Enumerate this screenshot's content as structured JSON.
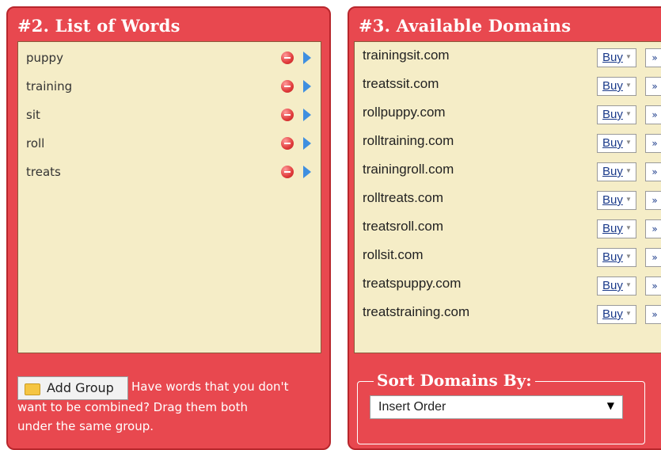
{
  "words_panel": {
    "title": "#2. List of Words",
    "words": [
      "puppy",
      "training",
      "sit",
      "roll",
      "treats"
    ],
    "add_group_label": "Add Group",
    "help_line1": "Have words that you don't",
    "help_line2": "want to be combined?  Drag them both",
    "help_line3": "under the same group."
  },
  "domains_panel": {
    "title": "#3. Available Domains",
    "domains": [
      "trainingsit.com",
      "treatssit.com",
      "rollpuppy.com",
      "rolltraining.com",
      "trainingroll.com",
      "rolltreats.com",
      "treatsroll.com",
      "rollsit.com",
      "treatspuppy.com",
      "treatstraining.com"
    ],
    "buy_label": "Buy",
    "more_label": "»",
    "sort_legend": "Sort Domains By:",
    "sort_selected": "Insert Order"
  },
  "colors": {
    "panel_bg": "#e8484f",
    "list_bg": "#f5edc7",
    "remove_icon": "#e03b3b",
    "arrow_icon": "#3f8fe0"
  }
}
